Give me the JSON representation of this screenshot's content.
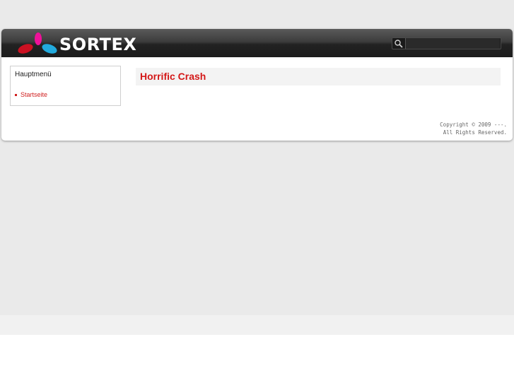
{
  "header": {
    "logo_text": "SORTEX",
    "search": {
      "placeholder": "",
      "value": ""
    }
  },
  "sidebar": {
    "title": "Hauptmenü",
    "items": [
      {
        "label": "Startseite"
      }
    ]
  },
  "main": {
    "title": "Horrific Crash"
  },
  "footer": {
    "copyright_line1": "Copyright © 2009 ---.",
    "copyright_line2": "All Rights Reserved."
  },
  "colors": {
    "accent": "#d41818",
    "header_dark": "#1c1c1c",
    "logo_red": "#cc1122",
    "logo_pink": "#ee1199",
    "logo_cyan": "#22aadd"
  }
}
